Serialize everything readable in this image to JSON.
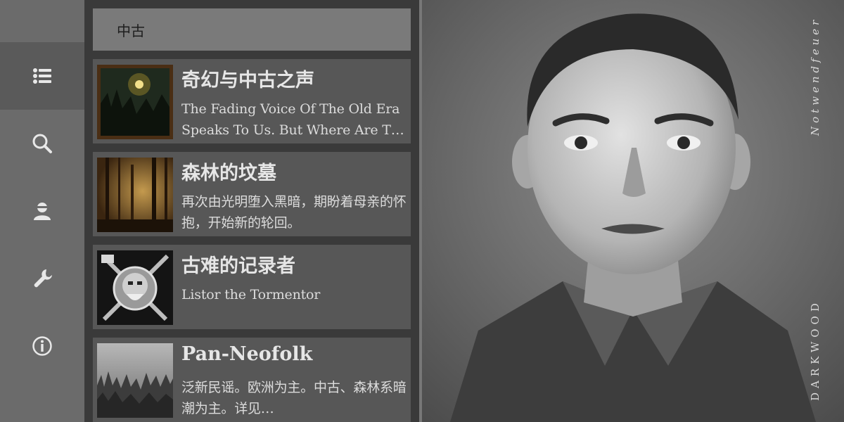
{
  "search": {
    "value": "中古"
  },
  "sidebar": {
    "items": [
      {
        "icon": "list-icon"
      },
      {
        "icon": "search-icon"
      },
      {
        "icon": "user-icon"
      },
      {
        "icon": "wrench-icon"
      },
      {
        "icon": "info-icon"
      }
    ]
  },
  "results": [
    {
      "title": "奇幻与中古之声",
      "description": "The Fading Voice Of The Old Era Speaks To Us. But Where Are T…"
    },
    {
      "title": "森林的坟墓",
      "description": "再次由光明堕入黑暗，期盼着母亲的怀抱，开始新的轮回。"
    },
    {
      "title": "古难的记录者",
      "description": "Listor the Tormentor"
    },
    {
      "title": "Pan-Neofolk",
      "description": "泛新民谣。欧洲为主。中古、森林系暗潮为主。详见…"
    }
  ],
  "cover": {
    "artist_text": "DARKWOOD",
    "album_text": "Notwendfeuer"
  },
  "colors": {
    "sidebar_bg": "#6b6b6b",
    "sidebar_active": "#5a5a5a",
    "panel_bg": "#3a3a3a",
    "card_bg": "#575757",
    "search_bg": "#7a7a7a",
    "icon": "#e8e8e8"
  }
}
